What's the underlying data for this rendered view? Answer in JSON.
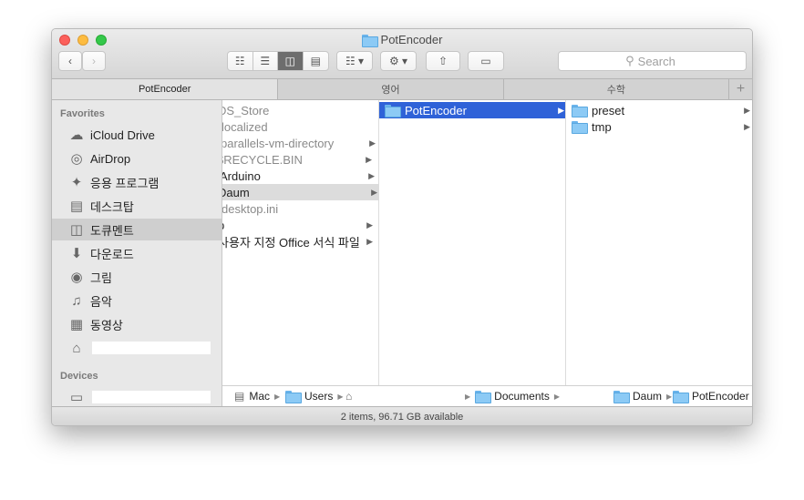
{
  "window": {
    "title": "PotEncoder"
  },
  "toolbar": {
    "back_icon": "chevron-left-icon",
    "forward_icon": "chevron-right-icon",
    "view_icons": [
      "icon-view-icon",
      "list-view-icon",
      "column-view-icon",
      "cover-flow-view-icon"
    ],
    "search_placeholder": "Search",
    "search_icon": "magnifier-icon"
  },
  "tabs": [
    {
      "label": "PotEncoder",
      "active": true
    },
    {
      "label": "영어",
      "active": false
    },
    {
      "label": "수학",
      "active": false
    }
  ],
  "sidebar": {
    "favorites_header": "Favorites",
    "favorites": [
      {
        "label": "iCloud Drive",
        "icon": "cloud-icon"
      },
      {
        "label": "AirDrop",
        "icon": "airdrop-icon"
      },
      {
        "label": "응용 프로그램",
        "icon": "applications-icon"
      },
      {
        "label": "데스크탑",
        "icon": "desktop-icon"
      },
      {
        "label": "도큐멘트",
        "icon": "documents-icon",
        "active": true
      },
      {
        "label": "다운로드",
        "icon": "downloads-icon"
      },
      {
        "label": "그림",
        "icon": "camera-icon"
      },
      {
        "label": "음악",
        "icon": "music-icon"
      },
      {
        "label": "동영상",
        "icon": "movies-icon"
      },
      {
        "label": "",
        "icon": "home-icon"
      }
    ],
    "devices_header": "Devices",
    "devices": [
      {
        "label": "",
        "icon": "laptop-icon"
      }
    ]
  },
  "columns": {
    "col1": [
      {
        "label": "DS_Store",
        "has_children": false,
        "grey": true
      },
      {
        "label": "localized",
        "has_children": false,
        "grey": true
      },
      {
        "label": "parallels-vm-directory",
        "has_children": true,
        "grey": true
      },
      {
        "label": "$RECYCLE.BIN",
        "has_children": true,
        "grey": true
      },
      {
        "label": "Arduino",
        "has_children": true,
        "grey": false
      },
      {
        "label": "Daum",
        "has_children": true,
        "grey": false,
        "selected": true
      },
      {
        "label": "desktop.ini",
        "has_children": false,
        "grey": true
      },
      {
        "label": "p",
        "has_children": true,
        "grey": false
      },
      {
        "label": "사용자 지정 Office 서식 파일",
        "has_children": true,
        "grey": false
      }
    ],
    "col2": [
      {
        "label": "PotEncoder",
        "has_children": true,
        "selected": true
      }
    ],
    "col3": [
      {
        "label": "preset",
        "has_children": true
      },
      {
        "label": "tmp",
        "has_children": true
      }
    ]
  },
  "pathbar": {
    "items": [
      "Mac",
      "Users",
      "",
      "Documents",
      "Daum",
      "PotEncoder"
    ]
  },
  "status": {
    "text": "2 items, 96.71 GB available"
  }
}
